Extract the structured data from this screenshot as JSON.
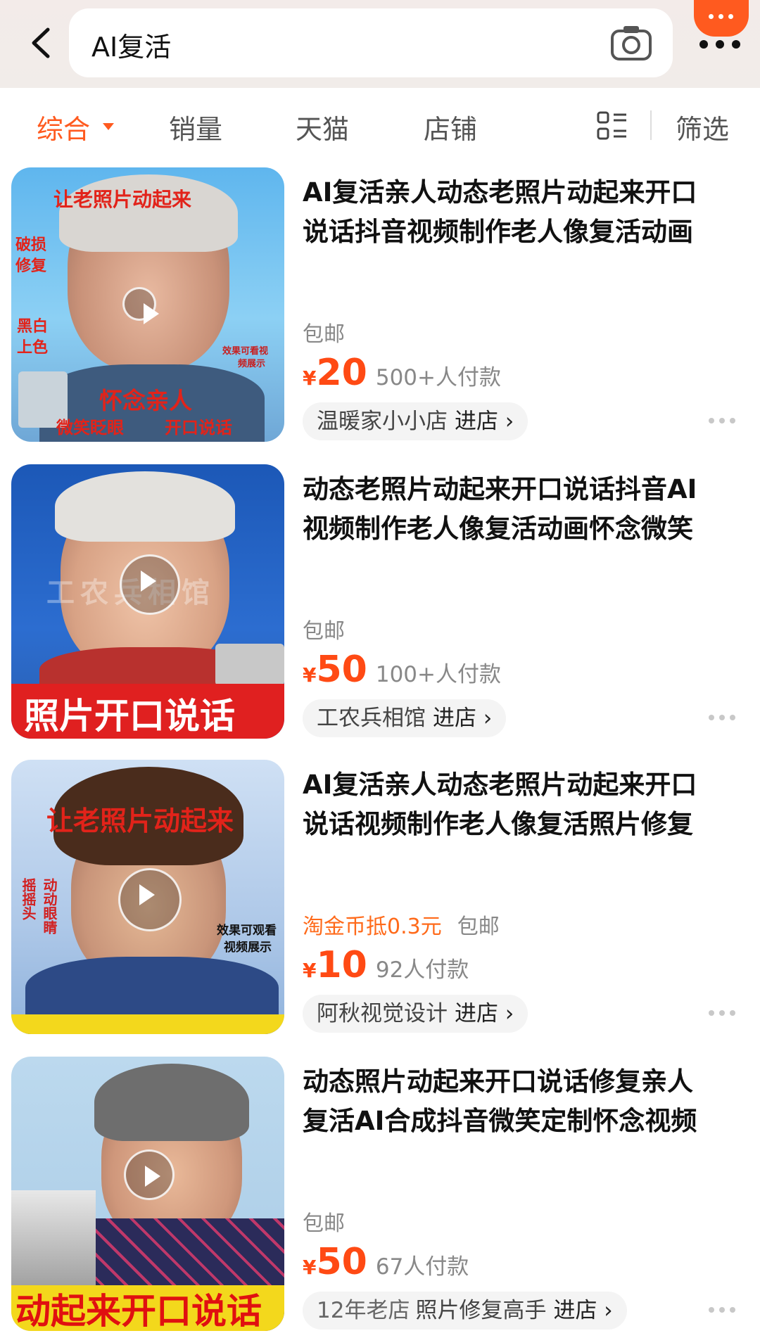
{
  "search": {
    "query": "AI复活"
  },
  "tabs": [
    {
      "label": "综合"
    },
    {
      "label": "销量"
    },
    {
      "label": "天猫"
    },
    {
      "label": "店铺"
    },
    {
      "label": "筛选"
    }
  ],
  "products": [
    {
      "title_line1": "AI复活亲人动态老照片动起来开口",
      "title_line2": "说话抖音视频制作老人像复活动画",
      "shipping": "包邮",
      "yen": "¥",
      "price": "20",
      "paid": "500+人付款",
      "shop": "温暖家小小店",
      "enter": "进店 ›",
      "thumb": {
        "t1": "让老照片动起来",
        "t2": "破损",
        "t3": "修复",
        "t4": "黑白",
        "t5": "上色",
        "t6": "效果可看视",
        "t7": "频展示",
        "t8": "怀念亲人",
        "t9": "微笑眨眼",
        "t10": "开口说话"
      }
    },
    {
      "title_line1": "动态老照片动起来开口说话抖音AI",
      "title_line2": "视频制作老人像复活动画怀念微笑",
      "shipping": "包邮",
      "yen": "¥",
      "price": "50",
      "paid": "100+人付款",
      "shop": "工农兵相馆",
      "enter": "进店 ›",
      "thumb": {
        "banner": "照片开口说话",
        "watermark": "工农兵相馆"
      }
    },
    {
      "title_line1": "AI复活亲人动态老照片动起来开口",
      "title_line2": "说话视频制作老人像复活照片修复",
      "coin": "淘金币抵0.3元",
      "shipping": "包邮",
      "yen": "¥",
      "price": "10",
      "paid": "92人付款",
      "shop": "阿秋视觉设计",
      "enter": "进店 ›",
      "thumb": {
        "t1": "让老照片动起来",
        "t2": "摇摇头",
        "t3": "动动眼睛",
        "t4": "效果可观看",
        "t5": "视频展示"
      }
    },
    {
      "title_line1": "动态照片动起来开口说话修复亲人",
      "title_line2": "复活AI合成抖音微笑定制怀念视频",
      "shipping": "包邮",
      "yen": "¥",
      "price": "50",
      "paid": "67人付款",
      "shop_tag": "12年老店",
      "shop": "照片修复高手",
      "enter": "进店 ›",
      "thumb": {
        "banner": "动起来开口说话"
      }
    }
  ],
  "colors": {
    "accent": "#ff5a1f",
    "price": "#ff4a14"
  }
}
